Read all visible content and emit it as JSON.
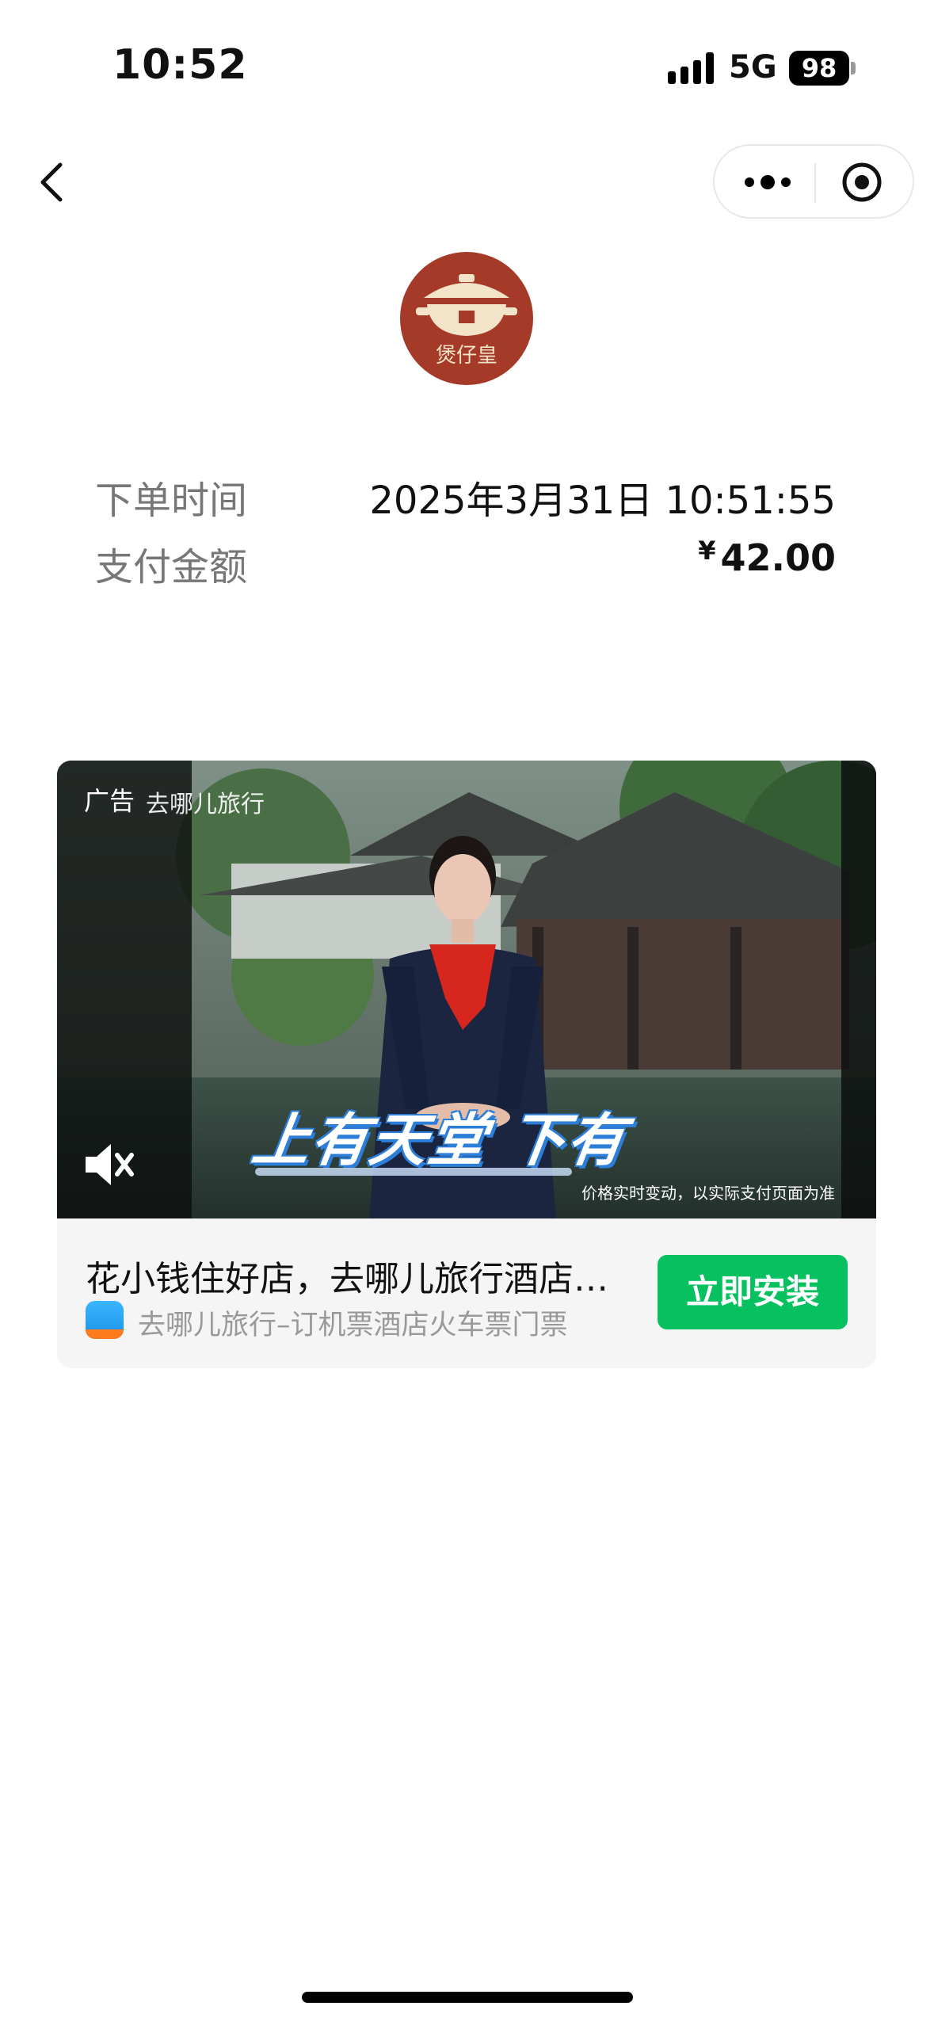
{
  "status_bar": {
    "time": "10:52",
    "network": "5G",
    "battery": "98"
  },
  "logo": {
    "brand_text": "煲仔皇"
  },
  "order": {
    "time_label": "下单时间",
    "time_value": "2025年3月31日 10:51:55",
    "amount_label": "支付金额",
    "amount_currency": "¥",
    "amount_value": "42.00"
  },
  "ad": {
    "tag": "广告",
    "brand_watermark": "去哪儿旅行",
    "caption": "上有天堂 下有",
    "disclaimer": "价格实时变动，以实际支付页面为准",
    "title": "花小钱住好店，去哪儿旅行酒店…",
    "app_name": "去哪儿旅行–订机票酒店火车票门票",
    "install_label": "立即安装",
    "install_color": "#07c160"
  }
}
